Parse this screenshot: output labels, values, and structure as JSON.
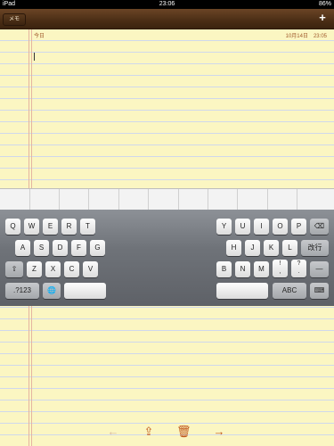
{
  "status": {
    "left": "iPad",
    "time": "23:06",
    "battery": "86%"
  },
  "header": {
    "memo_label": "メモ",
    "add_label": "+"
  },
  "note": {
    "date_left": "今日",
    "date_right": "10月14日　23:05"
  },
  "keyboard": {
    "left_row1": [
      "Q",
      "W",
      "E",
      "R",
      "T"
    ],
    "left_row2": [
      "A",
      "S",
      "D",
      "F",
      "G"
    ],
    "left_row3": [
      "Z",
      "X",
      "C",
      "V"
    ],
    "right_row1": [
      "Y",
      "U",
      "I",
      "O",
      "P"
    ],
    "right_row2": [
      "H",
      "J",
      "K",
      "L"
    ],
    "right_row3": [
      "B",
      "N",
      "M",
      "!",
      ",",
      "?",
      "."
    ],
    "special": {
      "numbers": ".?123",
      "return": "改行",
      "abc": "ABC",
      "dash": "—",
      "shift": "⇧",
      "globe": "🌐",
      "delete": "⌫",
      "hide": "⌨"
    }
  },
  "toolbar": {
    "prev": "←",
    "share": "⇪",
    "trash": "🗑",
    "next": "→"
  },
  "colors": {
    "accent": "#c1581c",
    "paper": "#fbf6c2",
    "header": "#4a2d15"
  }
}
